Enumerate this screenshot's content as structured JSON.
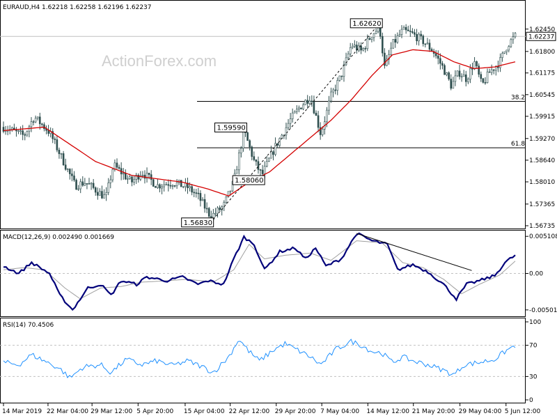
{
  "header": {
    "symbol_info": "EURAUD,H4  1.62218 1.62258 1.62196 1.62237",
    "watermark": "ActionForex.com"
  },
  "colors": {
    "candle": "#2f4f4f",
    "ma": "#d40000",
    "macd": "#00007a",
    "signal": "#a0a0a0",
    "rsi": "#1e90ff",
    "grid": "#c0c0c0",
    "level": "#000000"
  },
  "chart_data": [
    {
      "type": "candlestick",
      "name": "price",
      "ylim": [
        1.56735,
        1.6285
      ],
      "yticks": [
        "1.62450",
        "1.61800",
        "1.61175",
        "1.60545",
        "1.59915",
        "1.59270",
        "1.58640",
        "1.58010",
        "1.57365",
        "1.56735"
      ],
      "last_price": "1.62237",
      "last_value": 1.62237,
      "levels": [
        {
          "label": "38.2",
          "value": 1.6035
        },
        {
          "label": "61.8",
          "value": 1.59
        }
      ],
      "annotations": [
        {
          "text": "1.62620",
          "value": 1.6262,
          "pos": 0.735
        },
        {
          "text": "1.59590",
          "value": 1.5959,
          "pos": 0.47
        },
        {
          "text": "1.58060",
          "value": 1.5806,
          "pos": 0.505
        },
        {
          "text": "1.56830",
          "value": 1.5683,
          "pos": 0.405
        }
      ],
      "trendline": {
        "from": {
          "pos": 0.405,
          "value": 1.5683
        },
        "to": {
          "pos": 0.735,
          "value": 1.6262
        }
      },
      "anchors": [
        [
          0.0,
          1.596
        ],
        [
          0.04,
          1.5935
        ],
        [
          0.06,
          1.599
        ],
        [
          0.09,
          1.5945
        ],
        [
          0.14,
          1.579
        ],
        [
          0.16,
          1.58
        ],
        [
          0.2,
          1.5755
        ],
        [
          0.215,
          1.585
        ],
        [
          0.25,
          1.58
        ],
        [
          0.27,
          1.583
        ],
        [
          0.3,
          1.579
        ],
        [
          0.33,
          1.58
        ],
        [
          0.36,
          1.5785
        ],
        [
          0.38,
          1.576
        ],
        [
          0.405,
          1.57
        ],
        [
          0.43,
          1.573
        ],
        [
          0.45,
          1.58
        ],
        [
          0.47,
          1.595
        ],
        [
          0.49,
          1.586
        ],
        [
          0.505,
          1.582
        ],
        [
          0.53,
          1.59
        ],
        [
          0.56,
          1.598
        ],
        [
          0.58,
          1.602
        ],
        [
          0.6,
          1.605
        ],
        [
          0.62,
          1.594
        ],
        [
          0.64,
          1.605
        ],
        [
          0.66,
          1.611
        ],
        [
          0.68,
          1.62
        ],
        [
          0.7,
          1.618
        ],
        [
          0.72,
          1.623
        ],
        [
          0.735,
          1.625
        ],
        [
          0.745,
          1.613
        ],
        [
          0.76,
          1.62
        ],
        [
          0.78,
          1.624
        ],
        [
          0.8,
          1.623
        ],
        [
          0.82,
          1.621
        ],
        [
          0.84,
          1.618
        ],
        [
          0.86,
          1.613
        ],
        [
          0.875,
          1.608
        ],
        [
          0.89,
          1.612
        ],
        [
          0.905,
          1.61
        ],
        [
          0.92,
          1.615
        ],
        [
          0.935,
          1.608
        ],
        [
          0.95,
          1.612
        ],
        [
          0.97,
          1.615
        ],
        [
          0.985,
          1.62
        ],
        [
          1.0,
          1.6224
        ]
      ],
      "ma_anchors": [
        [
          0.0,
          1.595
        ],
        [
          0.08,
          1.596
        ],
        [
          0.12,
          1.592
        ],
        [
          0.18,
          1.586
        ],
        [
          0.25,
          1.582
        ],
        [
          0.3,
          1.581
        ],
        [
          0.35,
          1.58
        ],
        [
          0.4,
          1.578
        ],
        [
          0.44,
          1.576
        ],
        [
          0.48,
          1.58
        ],
        [
          0.52,
          1.583
        ],
        [
          0.56,
          1.588
        ],
        [
          0.6,
          1.593
        ],
        [
          0.64,
          1.598
        ],
        [
          0.68,
          1.604
        ],
        [
          0.72,
          1.611
        ],
        [
          0.76,
          1.617
        ],
        [
          0.8,
          1.6185
        ],
        [
          0.84,
          1.618
        ],
        [
          0.88,
          1.615
        ],
        [
          0.92,
          1.613
        ],
        [
          0.96,
          1.6135
        ],
        [
          1.0,
          1.615
        ]
      ]
    },
    {
      "type": "line",
      "name": "MACD(12,26,9)",
      "label": "MACD(12,26,9) 0.002490 0.001669",
      "ylim": [
        -0.0058,
        0.0058
      ],
      "yticks": [
        "0.005108",
        "0.00",
        "-0.005019"
      ],
      "ytick_values": [
        0.005108,
        0.0,
        -0.005019
      ],
      "trendline": {
        "from": {
          "pos": 0.69,
          "value": 0.0055
        },
        "to": {
          "pos": 0.915,
          "value": 0.0004
        }
      },
      "macd_anchors": [
        [
          0.0,
          0.001
        ],
        [
          0.03,
          0.0
        ],
        [
          0.055,
          0.0015
        ],
        [
          0.09,
          0.0
        ],
        [
          0.11,
          -0.003
        ],
        [
          0.135,
          -0.005
        ],
        [
          0.165,
          -0.002
        ],
        [
          0.19,
          -0.0015
        ],
        [
          0.21,
          -0.003
        ],
        [
          0.23,
          -0.001
        ],
        [
          0.26,
          -0.0015
        ],
        [
          0.28,
          -0.0005
        ],
        [
          0.32,
          -0.001
        ],
        [
          0.35,
          -0.0005
        ],
        [
          0.38,
          -0.0015
        ],
        [
          0.4,
          -0.001
        ],
        [
          0.43,
          -0.0015
        ],
        [
          0.45,
          0.002
        ],
        [
          0.47,
          0.005
        ],
        [
          0.49,
          0.004
        ],
        [
          0.51,
          0.0005
        ],
        [
          0.54,
          0.003
        ],
        [
          0.57,
          0.0035
        ],
        [
          0.59,
          0.002
        ],
        [
          0.61,
          0.0035
        ],
        [
          0.63,
          0.001
        ],
        [
          0.66,
          0.002
        ],
        [
          0.69,
          0.0055
        ],
        [
          0.72,
          0.0045
        ],
        [
          0.75,
          0.004
        ],
        [
          0.77,
          0.0005
        ],
        [
          0.8,
          0.0012
        ],
        [
          0.83,
          0.0002
        ],
        [
          0.86,
          -0.0015
        ],
        [
          0.885,
          -0.0035
        ],
        [
          0.905,
          -0.0015
        ],
        [
          0.93,
          -0.001
        ],
        [
          0.96,
          -0.0003
        ],
        [
          0.98,
          0.0015
        ],
        [
          1.0,
          0.0025
        ]
      ],
      "signal_anchors": [
        [
          0.0,
          0.0005
        ],
        [
          0.04,
          0.0008
        ],
        [
          0.08,
          0.0005
        ],
        [
          0.12,
          -0.002
        ],
        [
          0.15,
          -0.0035
        ],
        [
          0.19,
          -0.002
        ],
        [
          0.23,
          -0.0018
        ],
        [
          0.27,
          -0.0012
        ],
        [
          0.32,
          -0.001
        ],
        [
          0.36,
          -0.0008
        ],
        [
          0.41,
          -0.0012
        ],
        [
          0.45,
          0.0005
        ],
        [
          0.48,
          0.004
        ],
        [
          0.51,
          0.002
        ],
        [
          0.55,
          0.0025
        ],
        [
          0.6,
          0.0028
        ],
        [
          0.64,
          0.0018
        ],
        [
          0.69,
          0.0045
        ],
        [
          0.74,
          0.0042
        ],
        [
          0.78,
          0.0015
        ],
        [
          0.82,
          0.0008
        ],
        [
          0.86,
          -0.0008
        ],
        [
          0.895,
          -0.0028
        ],
        [
          0.93,
          -0.0015
        ],
        [
          0.97,
          -0.0002
        ],
        [
          1.0,
          0.0017
        ]
      ]
    },
    {
      "type": "line",
      "name": "RSI(14)",
      "label": "RSI(14) 70.4506",
      "ylim": [
        0,
        100
      ],
      "yticks": [
        "100",
        "70",
        "30",
        "0"
      ],
      "ytick_values": [
        100,
        70,
        30,
        0
      ],
      "levels": [
        70,
        30
      ],
      "rsi_anchors": [
        [
          0.0,
          48
        ],
        [
          0.03,
          45
        ],
        [
          0.055,
          58
        ],
        [
          0.08,
          50
        ],
        [
          0.11,
          40
        ],
        [
          0.13,
          28
        ],
        [
          0.155,
          42
        ],
        [
          0.19,
          45
        ],
        [
          0.21,
          35
        ],
        [
          0.24,
          52
        ],
        [
          0.27,
          45
        ],
        [
          0.3,
          50
        ],
        [
          0.33,
          44
        ],
        [
          0.36,
          50
        ],
        [
          0.39,
          42
        ],
        [
          0.41,
          35
        ],
        [
          0.44,
          55
        ],
        [
          0.46,
          78
        ],
        [
          0.48,
          62
        ],
        [
          0.5,
          50
        ],
        [
          0.53,
          65
        ],
        [
          0.55,
          72
        ],
        [
          0.58,
          62
        ],
        [
          0.6,
          55
        ],
        [
          0.62,
          45
        ],
        [
          0.65,
          65
        ],
        [
          0.68,
          75
        ],
        [
          0.7,
          70
        ],
        [
          0.72,
          62
        ],
        [
          0.74,
          60
        ],
        [
          0.76,
          48
        ],
        [
          0.78,
          55
        ],
        [
          0.8,
          50
        ],
        [
          0.83,
          45
        ],
        [
          0.86,
          38
        ],
        [
          0.88,
          32
        ],
        [
          0.9,
          45
        ],
        [
          0.93,
          48
        ],
        [
          0.96,
          52
        ],
        [
          0.98,
          62
        ],
        [
          1.0,
          70
        ]
      ]
    }
  ],
  "x_axis": {
    "labels": [
      {
        "text": "14 Mar 2019",
        "pos": 0.0
      },
      {
        "text": "22 Mar 04:00",
        "pos": 0.087
      },
      {
        "text": "29 Mar 12:00",
        "pos": 0.173
      },
      {
        "text": "5 Apr 20:00",
        "pos": 0.263
      },
      {
        "text": "15 Apr 04:00",
        "pos": 0.355
      },
      {
        "text": "22 Apr 12:00",
        "pos": 0.443
      },
      {
        "text": "29 Apr 20:00",
        "pos": 0.533
      },
      {
        "text": "7 May 04:00",
        "pos": 0.622
      },
      {
        "text": "14 May 12:00",
        "pos": 0.712
      },
      {
        "text": "21 May 20:00",
        "pos": 0.801
      },
      {
        "text": "29 May 04:00",
        "pos": 0.892
      },
      {
        "text": "5 Jun 12:00",
        "pos": 0.982
      }
    ]
  }
}
